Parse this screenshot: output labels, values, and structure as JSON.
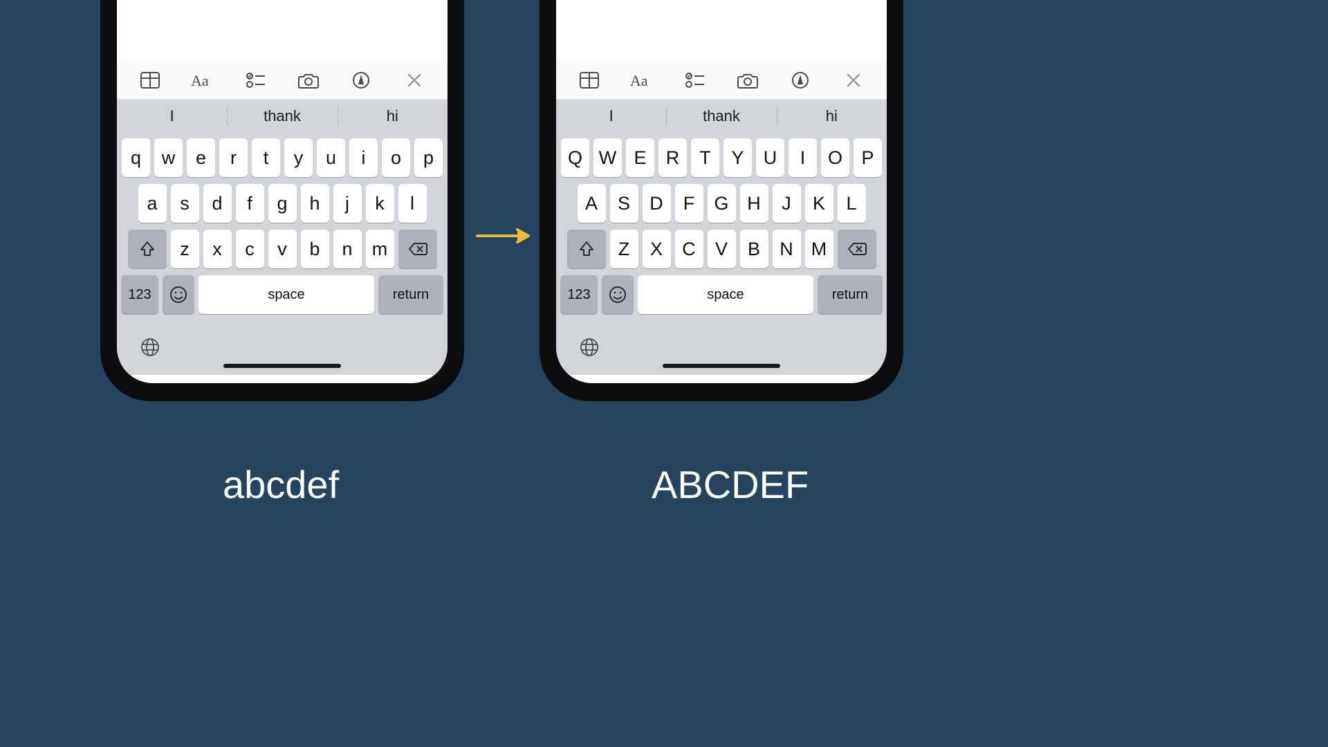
{
  "captions": {
    "left": "abcdef",
    "right": "ABCDEF"
  },
  "suggestions": {
    "s1": "I",
    "s2": "thank",
    "s3": "hi"
  },
  "bottom_row": {
    "num": "123",
    "space": "space",
    "ret": "return"
  },
  "keys_lower": {
    "r1": {
      "k0": "q",
      "k1": "w",
      "k2": "e",
      "k3": "r",
      "k4": "t",
      "k5": "y",
      "k6": "u",
      "k7": "i",
      "k8": "o",
      "k9": "p"
    },
    "r2": {
      "k0": "a",
      "k1": "s",
      "k2": "d",
      "k3": "f",
      "k4": "g",
      "k5": "h",
      "k6": "j",
      "k7": "k",
      "k8": "l"
    },
    "r3": {
      "k0": "z",
      "k1": "x",
      "k2": "c",
      "k3": "v",
      "k4": "b",
      "k5": "n",
      "k6": "m"
    }
  },
  "keys_upper": {
    "r1": {
      "k0": "Q",
      "k1": "W",
      "k2": "E",
      "k3": "R",
      "k4": "T",
      "k5": "Y",
      "k6": "U",
      "k7": "I",
      "k8": "O",
      "k9": "P"
    },
    "r2": {
      "k0": "A",
      "k1": "S",
      "k2": "D",
      "k3": "F",
      "k4": "G",
      "k5": "H",
      "k6": "J",
      "k7": "K",
      "k8": "L"
    },
    "r3": {
      "k0": "Z",
      "k1": "X",
      "k2": "C",
      "k3": "V",
      "k4": "B",
      "k5": "N",
      "k6": "M"
    }
  }
}
